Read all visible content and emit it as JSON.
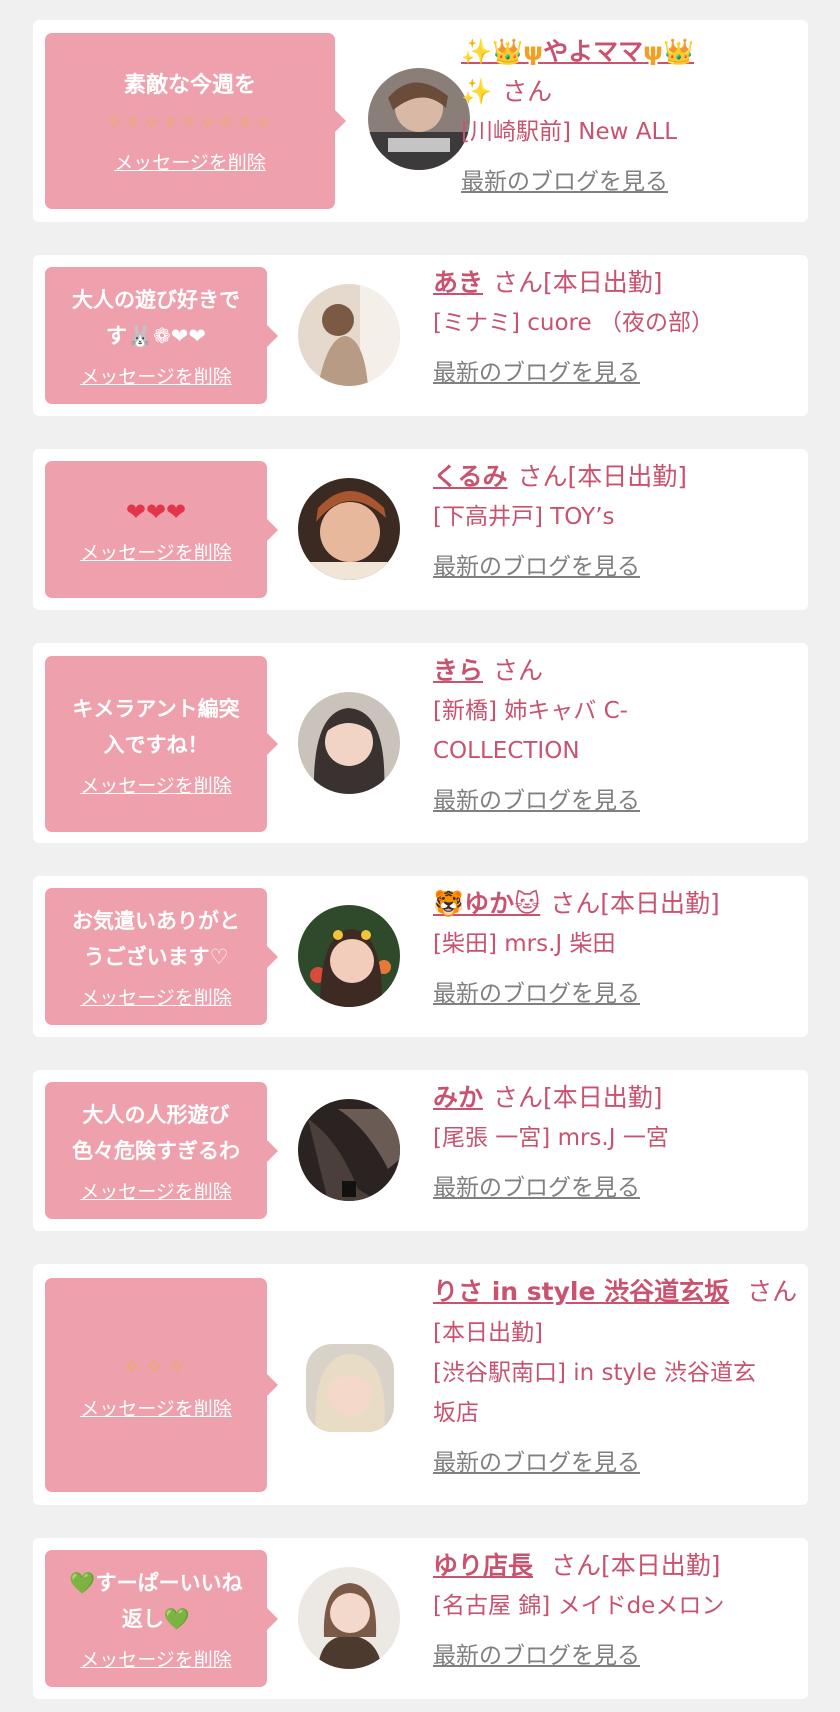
{
  "colors": {
    "page_bg": "#f0f0f1",
    "card_bg": "#ffffff",
    "bubble_bg": "#eea1ad",
    "name_color": "#c9536f",
    "blog_link": "#808080"
  },
  "common": {
    "delete_label": "メッセージを削除",
    "blog_label": "最新のブログを見る"
  },
  "entries": [
    {
      "bubble_line1": "素敵な今週を",
      "bubble_line2": "✧✧✧✧✧✧✧✧✧",
      "name_prefix": "✨👑ψ",
      "name": "やよママ",
      "name_suffix": "ψ👑",
      "name_line2": "✨",
      "san": "さん",
      "shop": "[川崎駅前] New ALL"
    },
    {
      "bubble_text": "大人の遊び好きで\nす🐰❁❤❤",
      "name": "あき",
      "san": "さん[本日出勤]",
      "shop": "[ミナミ] cuore （夜の部）"
    },
    {
      "bubble_text": "❤❤❤",
      "name": "くるみ",
      "san": "さん[本日出勤]",
      "shop": "[下高井戸] TOY’s"
    },
    {
      "bubble_text": "キメラアント編突\n入ですね！",
      "name": "きら",
      "san": "さん",
      "shop": "[新橋] 姉キャバ C-\nCOLLECTION"
    },
    {
      "bubble_text": "お気遣いありがと\nうございます♡",
      "name": "🐯ゆか🐱",
      "san": "さん[本日出勤]",
      "shop": "[柴田] mrs.J 柴田"
    },
    {
      "bubble_text": "大人の人形遊び\n色々危険すぎるわ",
      "name": "みか",
      "san": "さん[本日出勤]",
      "shop": "[尾張 一宮] mrs.J 一宮"
    },
    {
      "bubble_text": "✧✧✧",
      "name": "りさ in style 渋谷道玄坂",
      "san": "さん",
      "san_line2": "[本日出勤]",
      "shop": "[渋谷駅南口] in style 渋谷道玄\n坂店"
    },
    {
      "bubble_text": "💚すーぱーいいね\n返し💚",
      "name": "ゆり店長",
      "san": "さん[本日出勤]",
      "shop": "[名古屋 錦] メイドdeメロン"
    }
  ]
}
